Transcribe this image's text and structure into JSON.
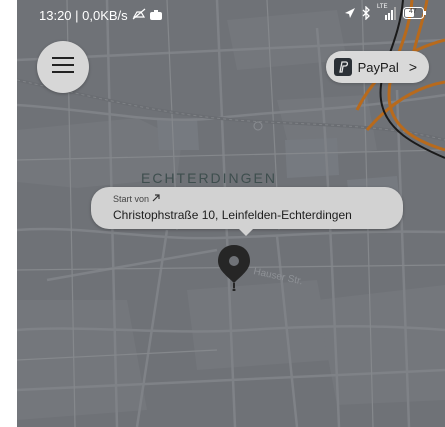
{
  "status_bar": {
    "time_network": "13:20 | 0,0KB/s",
    "icons": [
      "mute-icon",
      "camera-icon",
      "location-icon",
      "bluetooth-icon",
      "signal-icon",
      "battery-icon"
    ],
    "network_badge": "LTE",
    "battery_level": "47"
  },
  "header": {
    "menu_icon": "hamburger-menu-icon",
    "payment": {
      "label": "PayPal",
      "icon": "paypal-icon",
      "chevron": ">"
    }
  },
  "map": {
    "area_label": "ECHTERDINGEN",
    "street_label": "Hauser Str.",
    "colors": {
      "background": "#6f7277",
      "roads": "#7b7e83",
      "highway": "#b86a1c",
      "label": "#3e4e4e"
    }
  },
  "start_callout": {
    "label": "Start von",
    "address": "Christophstraße 10, Leinfelden-Echterdingen",
    "icon": "arrow-up-right-icon"
  },
  "pin": {
    "icon": "map-pin-icon"
  }
}
